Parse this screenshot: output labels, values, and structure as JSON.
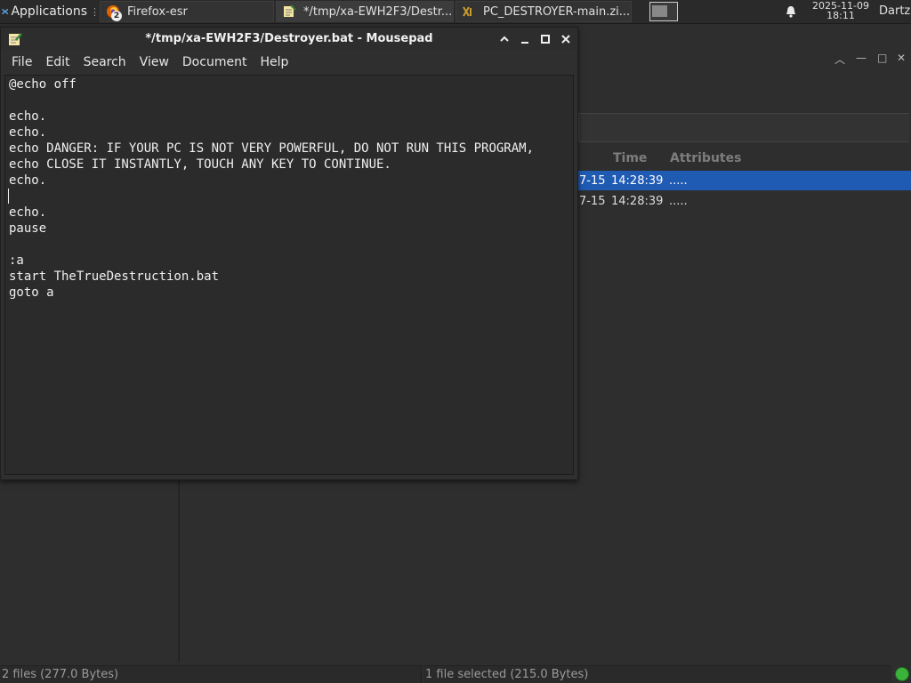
{
  "panel": {
    "applications_label": "Applications",
    "tasks": [
      {
        "label": "Firefox-esr",
        "badge": "2"
      },
      {
        "label": "*/tmp/xa-EWH2F3/Destr..."
      },
      {
        "label": "PC_DESTROYER-main.zi..."
      }
    ],
    "clock_date": "2025-11-09",
    "clock_time": "18:11",
    "user": "Dartz"
  },
  "file_manager": {
    "columns": {
      "time": "Time",
      "attributes": "Attributes"
    },
    "rows": [
      {
        "date": "7-15",
        "time": "14:28:39",
        "attributes": ".....",
        "selected": true
      },
      {
        "date": "7-15",
        "time": "14:28:39",
        "attributes": ".....",
        "selected": false
      }
    ],
    "status_left": "2 files  (277.0 Bytes)",
    "status_right": "1 file selected (215.0 Bytes)"
  },
  "mousepad": {
    "title": "*/tmp/xa-EWH2F3/Destroyer.bat - Mousepad",
    "menu": [
      "File",
      "Edit",
      "Search",
      "View",
      "Document",
      "Help"
    ],
    "lines": [
      "@echo off",
      "",
      "echo.",
      "echo.",
      "echo DANGER: IF YOUR PC IS NOT VERY POWERFUL, DO NOT RUN THIS PROGRAM,",
      "echo CLOSE IT INSTANTLY, TOUCH ANY KEY TO CONTINUE.",
      "echo.",
      "",
      "echo.",
      "pause",
      "",
      ":a",
      "start TheTrueDestruction.bat",
      "goto a"
    ]
  },
  "colors": {
    "selection": "#1f5ab3",
    "status_ok": "#3bb33b"
  }
}
